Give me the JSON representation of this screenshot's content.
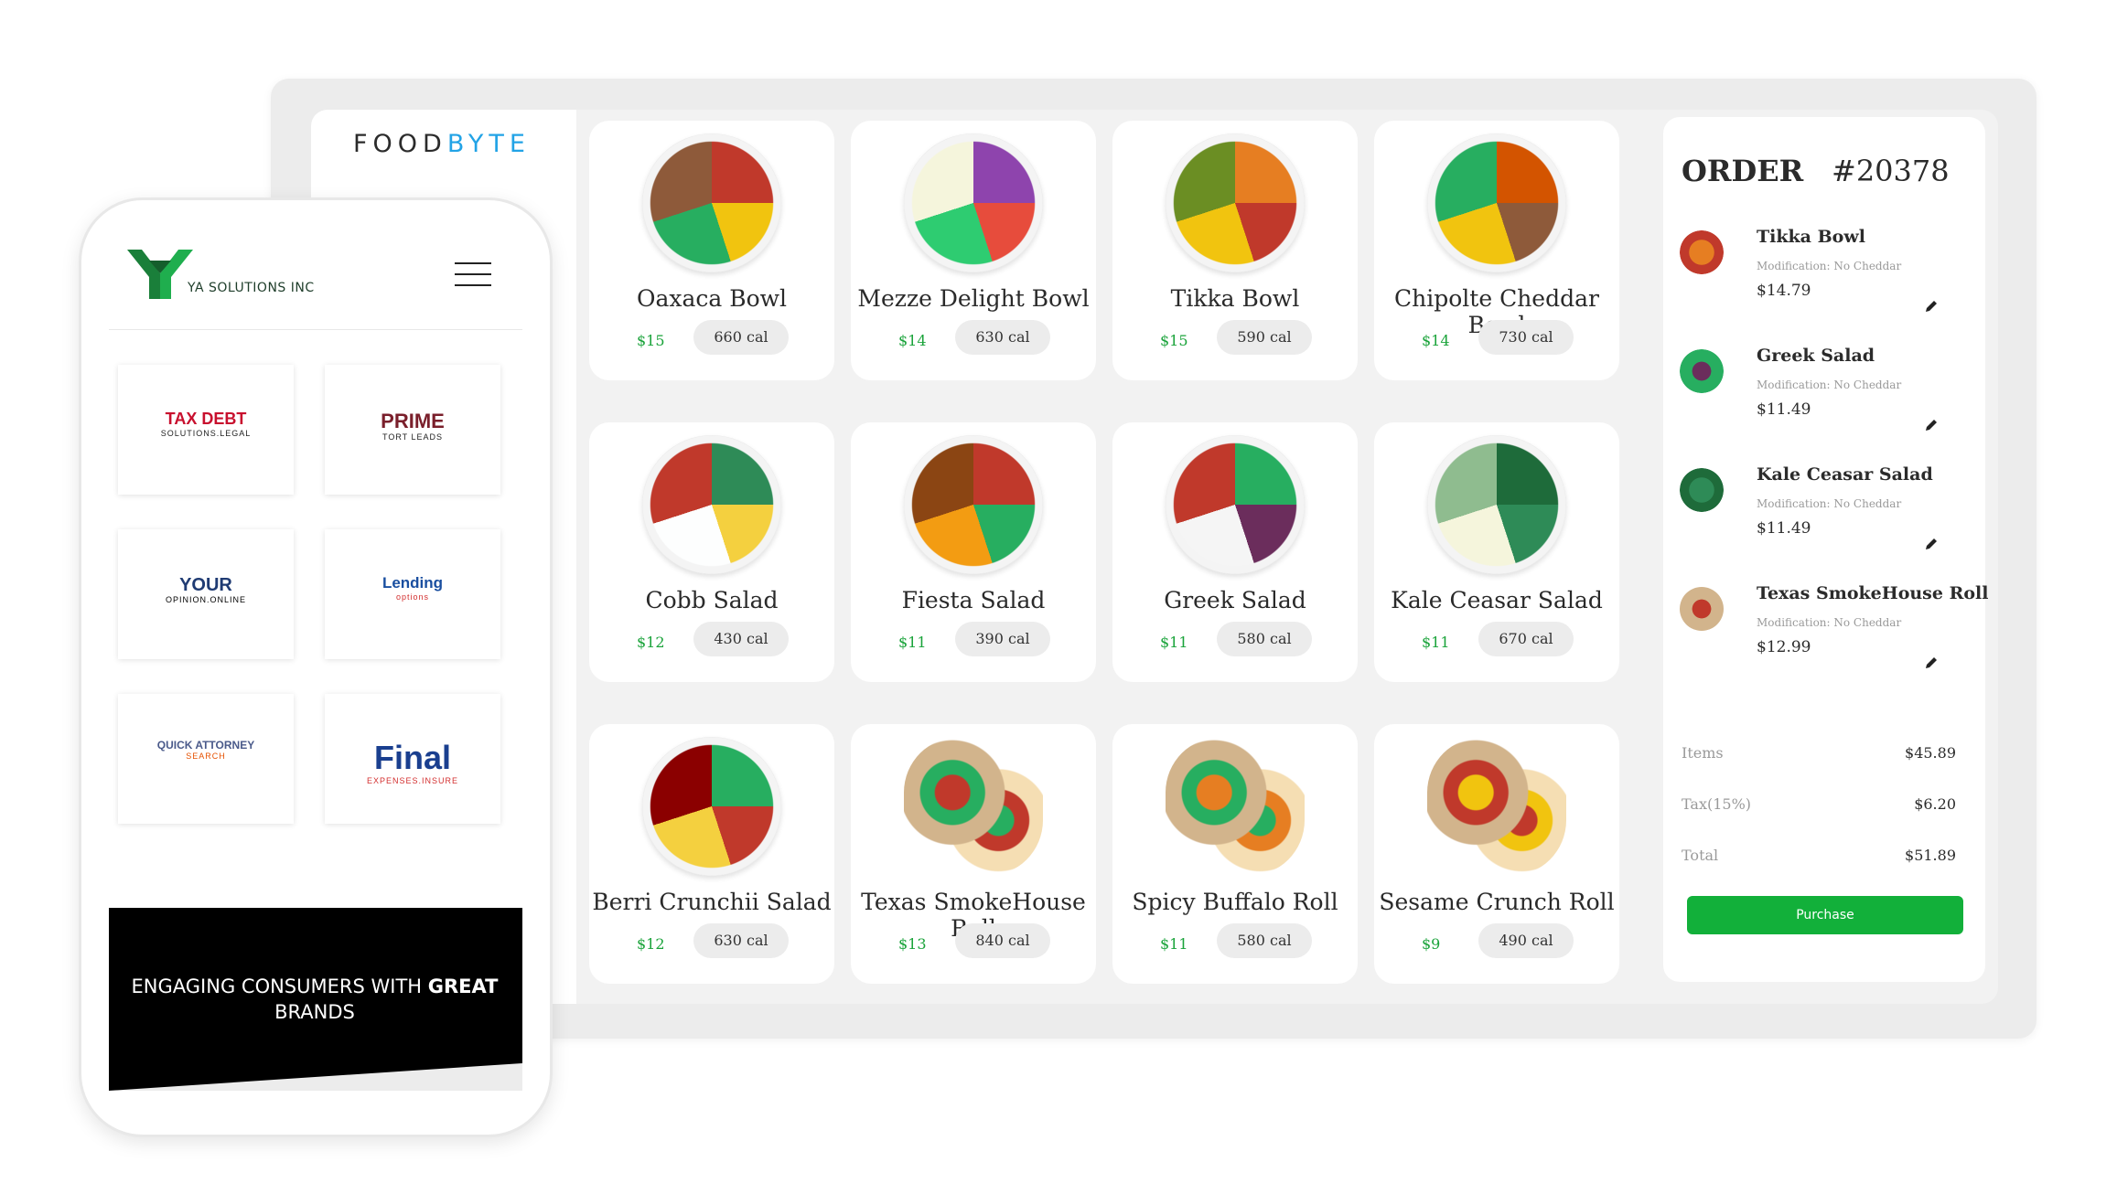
{
  "app": {
    "brand_left": "FOOD",
    "brand_right": "BYTE"
  },
  "menu": {
    "items": [
      {
        "name": "Oaxaca Bowl",
        "price": "$15",
        "cal": "660 cal"
      },
      {
        "name": "Mezze Delight Bowl",
        "price": "$14",
        "cal": "630 cal"
      },
      {
        "name": "Tikka Bowl",
        "price": "$15",
        "cal": "590 cal"
      },
      {
        "name": "Chipolte Cheddar Bowl",
        "price": "$14",
        "cal": "730 cal"
      },
      {
        "name": "Cobb Salad",
        "price": "$12",
        "cal": "430 cal"
      },
      {
        "name": "Fiesta Salad",
        "price": "$11",
        "cal": "390 cal"
      },
      {
        "name": "Greek Salad",
        "price": "$11",
        "cal": "580 cal"
      },
      {
        "name": "Kale Ceasar Salad",
        "price": "$11",
        "cal": "670 cal"
      },
      {
        "name": "Berri Crunchii Salad",
        "price": "$12",
        "cal": "630 cal"
      },
      {
        "name": "Texas SmokeHouse Roll",
        "price": "$13",
        "cal": "840 cal"
      },
      {
        "name": "Spicy Buffalo Roll",
        "price": "$11",
        "cal": "580 cal"
      },
      {
        "name": "Sesame Crunch Roll",
        "price": "$9",
        "cal": "490 cal"
      }
    ]
  },
  "order": {
    "title": "ORDER",
    "number": "#20378",
    "items": [
      {
        "name": "Tikka Bowl",
        "modification": "Modification: No Cheddar",
        "price": "$14.79"
      },
      {
        "name": "Greek Salad",
        "modification": "Modification: No Cheddar",
        "price": "$11.49"
      },
      {
        "name": "Kale Ceasar Salad",
        "modification": "Modification: No Cheddar",
        "price": "$11.49"
      },
      {
        "name": "Texas SmokeHouse Roll",
        "modification": "Modification: No Cheddar",
        "price": "$12.99"
      }
    ],
    "items_label": "Items",
    "items_value": "$45.89",
    "tax_label": "Tax(15%)",
    "tax_value": "$6.20",
    "total_label": "Total",
    "total_value": "$51.89",
    "purchase_label": "Purchase"
  },
  "phone": {
    "company": "YA SOLUTIONS INC",
    "partners": [
      {
        "line1": "TAX DEBT",
        "line2": "SOLUTIONS.LEGAL"
      },
      {
        "line1": "PRIME",
        "line2": "TORT LEADS"
      },
      {
        "line1": "YOUR",
        "line2": "OPINION.ONLINE"
      },
      {
        "line1": "Lending",
        "line2": "options"
      },
      {
        "line1": "QUICK ATTORNEY",
        "line2": "SEARCH"
      },
      {
        "line1": "Final",
        "line2": "EXPENSES.INSURE"
      }
    ],
    "banner_normal": "ENGAGING CONSUMERS WITH ",
    "banner_bold": "GREAT",
    "banner_line2": "BRANDS"
  },
  "colors": {
    "accent_green": "#12b03a",
    "brand_blue": "#22a3e6",
    "price_green": "#1aa33a"
  }
}
